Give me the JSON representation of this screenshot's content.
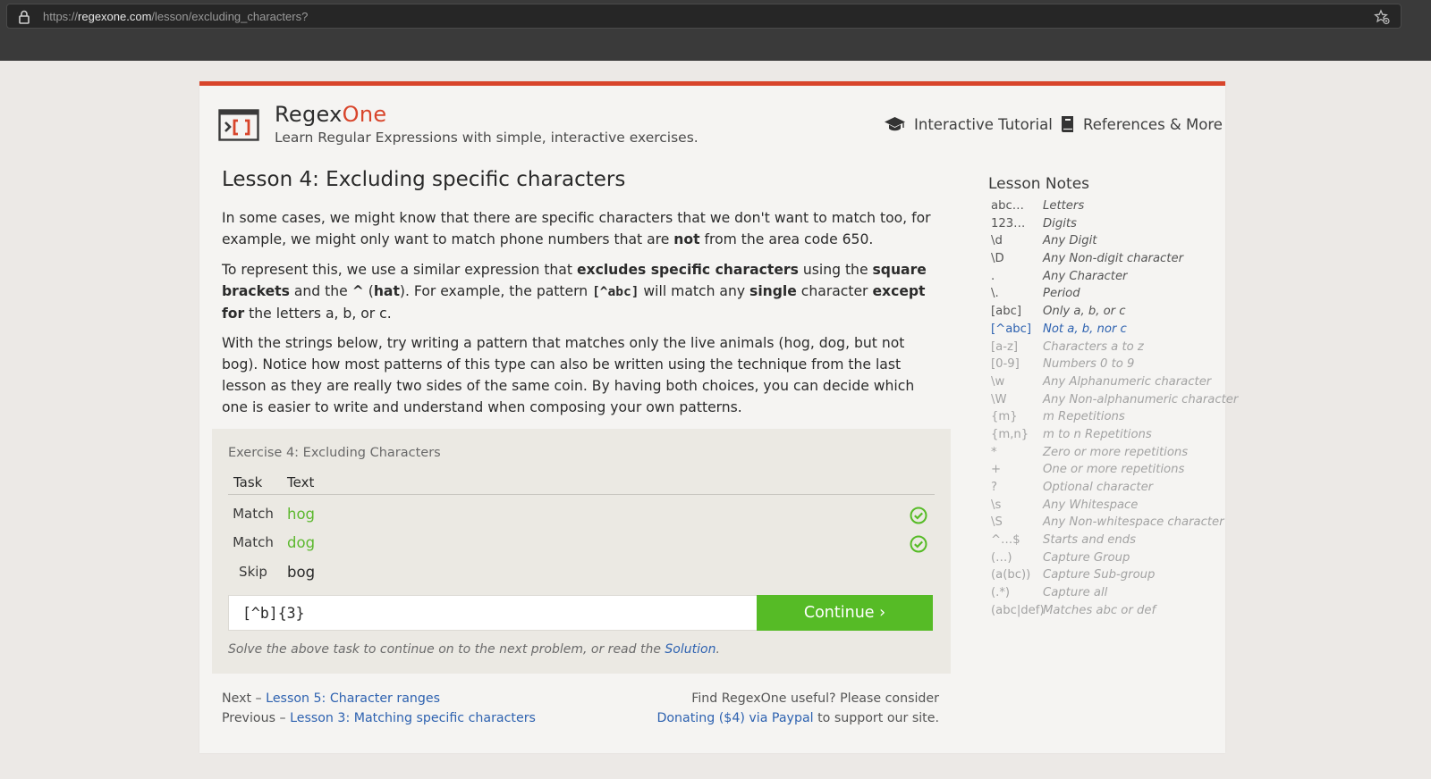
{
  "browser": {
    "url_prefix": "https://",
    "url_domain": "regexone.com",
    "url_path": "/lesson/excluding_characters?"
  },
  "header": {
    "brand_main": "Regex",
    "brand_accent": "One",
    "tagline": "Learn Regular Expressions with simple, interactive exercises.",
    "nav_tutorial": "Interactive Tutorial",
    "nav_references": "References & More"
  },
  "lesson": {
    "title": "Lesson 4: Excluding specific characters",
    "p1": [
      "In some cases, we might know that there are specific characters that we don't want to match too, for example, we might only want to match phone numbers that are ",
      "not",
      " from the area code 650."
    ],
    "p2": [
      "To represent this, we use a similar expression that ",
      "excludes specific characters",
      " using the ",
      "square brackets",
      " and the ",
      "^",
      " (",
      "hat",
      "). For example, the pattern ",
      "[^abc]",
      " will match any ",
      "single",
      " character ",
      "except for",
      " the letters a, b, or c."
    ],
    "p3": "With the strings below, try writing a pattern that matches only the live animals (hog, dog, but not bog). Notice how most patterns of this type can also be written using the technique from the last lesson as they are really two sides of the same coin. By having both choices, you can decide which one is easier to write and understand when composing your own patterns."
  },
  "exercise": {
    "title": "Exercise 4: Excluding Characters",
    "col_task": "Task",
    "col_text": "Text",
    "rows": [
      {
        "task": "Match",
        "text": "hog",
        "status": "passed"
      },
      {
        "task": "Match",
        "text": "dog",
        "status": "passed"
      },
      {
        "task": "Skip",
        "text": "bog",
        "status": "none"
      }
    ],
    "input_value": "[^b]{3}",
    "continue_label": "Continue ›",
    "hint_prefix": "Solve the above task to continue on to the next problem, or read the ",
    "hint_link": "Solution",
    "hint_suffix": "."
  },
  "footer": {
    "next_prefix": "Next – ",
    "next_link": "Lesson 5: Character ranges",
    "prev_prefix": "Previous – ",
    "prev_link": "Lesson 3: Matching specific characters",
    "support_line1": "Find RegexOne useful? Please consider",
    "donate_link": "Donating ($4) via Paypal",
    "support_suffix": " to support our site."
  },
  "notes": {
    "title": "Lesson Notes",
    "items": [
      {
        "key": "abc…",
        "desc": "Letters",
        "state": "dark"
      },
      {
        "key": "123…",
        "desc": "Digits",
        "state": "dark"
      },
      {
        "key": "\\d",
        "desc": "Any Digit",
        "state": "dark"
      },
      {
        "key": "\\D",
        "desc": "Any Non-digit character",
        "state": "dark"
      },
      {
        "key": ".",
        "desc": "Any Character",
        "state": "dark"
      },
      {
        "key": "\\.",
        "desc": "Period",
        "state": "dark"
      },
      {
        "key": "[abc]",
        "desc": "Only a, b, or c",
        "state": "dark"
      },
      {
        "key": "[^abc]",
        "desc": "Not a, b, nor c",
        "state": "active"
      },
      {
        "key": "[a-z]",
        "desc": "Characters a to z",
        "state": "light"
      },
      {
        "key": "[0-9]",
        "desc": "Numbers 0 to 9",
        "state": "light"
      },
      {
        "key": "\\w",
        "desc": "Any Alphanumeric character",
        "state": "light"
      },
      {
        "key": "\\W",
        "desc": "Any Non-alphanumeric character",
        "state": "light"
      },
      {
        "key": "{m}",
        "desc": "m Repetitions",
        "state": "light"
      },
      {
        "key": "{m,n}",
        "desc": "m to n Repetitions",
        "state": "light"
      },
      {
        "key": "*",
        "desc": "Zero or more repetitions",
        "state": "light"
      },
      {
        "key": "+",
        "desc": "One or more repetitions",
        "state": "light"
      },
      {
        "key": "?",
        "desc": "Optional character",
        "state": "light"
      },
      {
        "key": "\\s",
        "desc": "Any Whitespace",
        "state": "light"
      },
      {
        "key": "\\S",
        "desc": "Any Non-whitespace character",
        "state": "light"
      },
      {
        "key": "^…$",
        "desc": "Starts and ends",
        "state": "light"
      },
      {
        "key": "(…)",
        "desc": "Capture Group",
        "state": "light"
      },
      {
        "key": "(a(bc))",
        "desc": "Capture Sub-group",
        "state": "light"
      },
      {
        "key": "(.*)",
        "desc": "Capture all",
        "state": "light"
      },
      {
        "key": "(abc|def)",
        "desc": "Matches abc or def",
        "state": "light"
      }
    ]
  },
  "colors": {
    "accent_red": "#d8452b",
    "success_green": "#56bb26",
    "link_blue": "#2e62b0"
  },
  "icons": {
    "lock": "lock-icon",
    "bookmark": "star-bookmark-icon",
    "logo": "regexone-logo-icon",
    "tutorial": "graduation-cap-icon",
    "references": "book-icon",
    "check": "check-circle-icon"
  }
}
